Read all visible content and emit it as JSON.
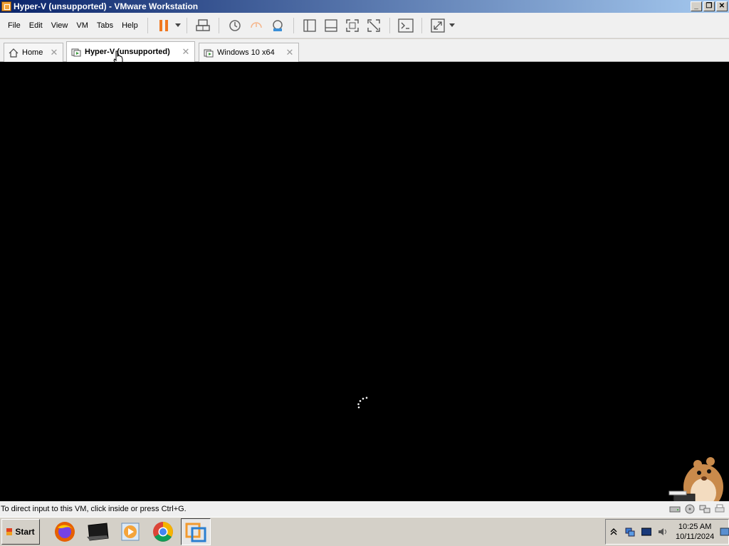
{
  "window": {
    "title": "Hyper-V (unsupported) - VMware Workstation"
  },
  "caption_buttons": {
    "minimize": "_",
    "restore": "❐",
    "close": "✕"
  },
  "menu": [
    {
      "label": "File"
    },
    {
      "label": "Edit"
    },
    {
      "label": "View"
    },
    {
      "label": "VM"
    },
    {
      "label": "Tabs"
    },
    {
      "label": "Help"
    }
  ],
  "toolbar": {
    "icons": [
      "pause-icon",
      "send-ctrl-alt-del-icon",
      "snapshot-icon",
      "revert-snapshot-icon",
      "snapshot-manager-icon",
      "library-view-icon",
      "thumbnail-bar-icon",
      "full-screen-icon",
      "unity-icon",
      "console-icon",
      "stretch-guest-icon"
    ],
    "colors": {
      "pause": "#f07820",
      "accent": "#3a8fd8"
    }
  },
  "tabs": [
    {
      "label": "Home",
      "icon": "home-icon",
      "active": false,
      "close": "✕"
    },
    {
      "label": "Hyper-V (unsupported)",
      "icon": "vm-icon",
      "active": true,
      "close": "✕"
    },
    {
      "label": "Windows 10 x64",
      "icon": "vm-icon",
      "active": false,
      "close": "✕"
    }
  ],
  "status": {
    "text": "To direct input to this VM, click inside or press Ctrl+G."
  },
  "taskbar": {
    "start_label": "Start",
    "apps": [
      "firefox-icon",
      "terminal-icon",
      "media-player-icon",
      "chrome-icon",
      "vmware-icon"
    ],
    "clock": {
      "time": "10:25 AM",
      "date": "10/11/2024"
    }
  }
}
